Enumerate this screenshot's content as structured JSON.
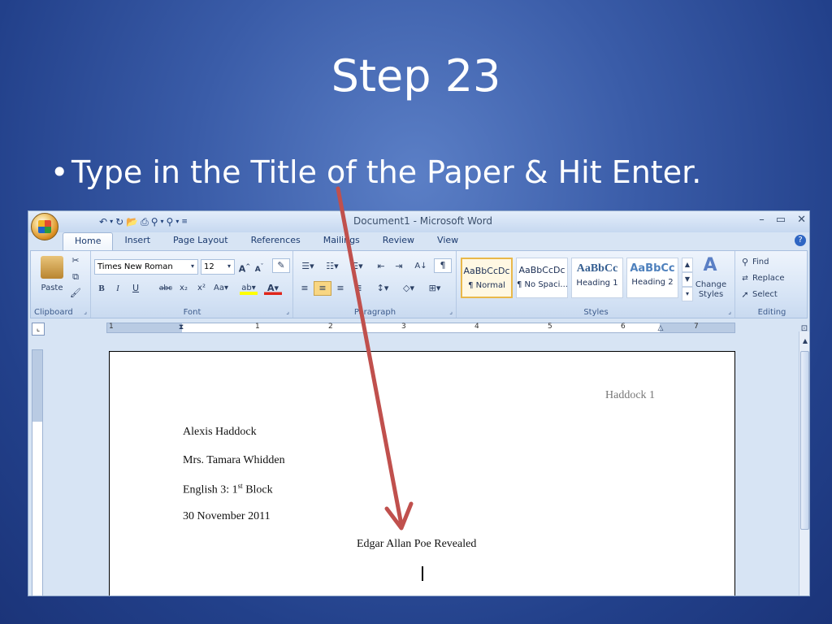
{
  "slide": {
    "title": "Step 23",
    "bullet": "Type in the Title of the Paper & Hit Enter.",
    "accent_color": "#c0504d"
  },
  "window": {
    "title": "Document1 - Microsoft Word",
    "controls": [
      "–",
      "▭",
      "✕"
    ]
  },
  "ribbon": {
    "tabs": [
      "Home",
      "Insert",
      "Page Layout",
      "References",
      "Mailings",
      "Review",
      "View"
    ],
    "active_tab": "Home",
    "clipboard": {
      "label": "Clipboard",
      "paste": "Paste"
    },
    "font": {
      "label": "Font",
      "name": "Times New Roman",
      "size": "12"
    },
    "paragraph": {
      "label": "Paragraph"
    },
    "styles": {
      "label": "Styles",
      "items": [
        {
          "sample": "AaBbCcDc",
          "name": "¶ Normal"
        },
        {
          "sample": "AaBbCcDc",
          "name": "¶ No Spaci..."
        },
        {
          "sample": "AaBbCc",
          "name": "Heading 1"
        },
        {
          "sample": "AaBbCc",
          "name": "Heading 2"
        }
      ],
      "change_styles": "Change Styles"
    },
    "editing": {
      "label": "Editing",
      "find": "Find",
      "replace": "Replace",
      "select": "Select"
    }
  },
  "ruler": {
    "numbers": [
      "1",
      "1",
      "2",
      "3",
      "4",
      "5",
      "6",
      "7"
    ]
  },
  "document": {
    "header": "Haddock 1",
    "lines": {
      "name": "Alexis Haddock",
      "teacher": "Mrs. Tamara  Whidden",
      "class_prefix": "English 3: 1",
      "class_sup": "st",
      "class_suffix": " Block",
      "date": "30 November 2011",
      "title": "Edgar Allan Poe Revealed"
    }
  }
}
